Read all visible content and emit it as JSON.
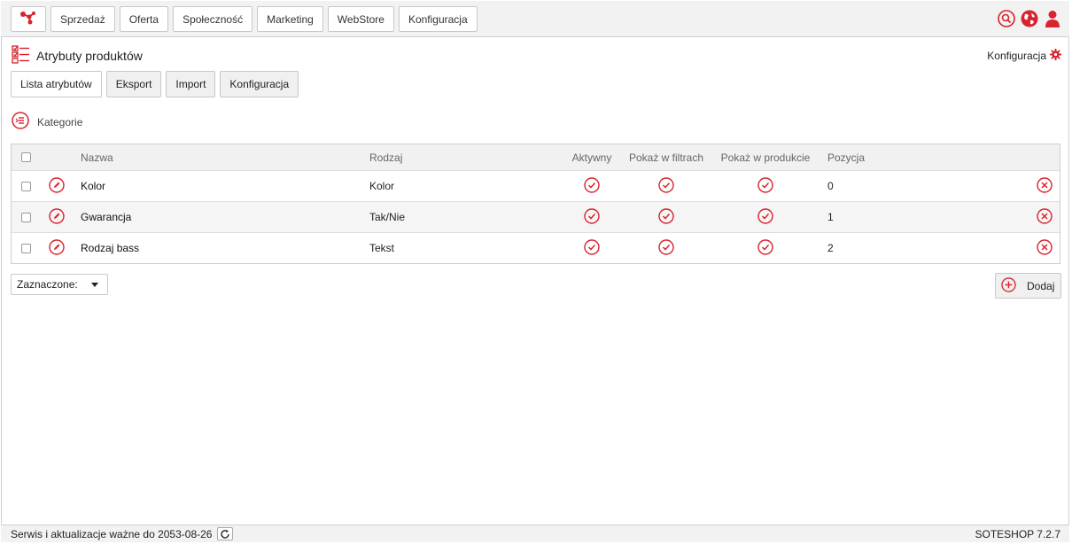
{
  "nav": [
    "Sprzedaż",
    "Oferta",
    "Społeczność",
    "Marketing",
    "WebStore",
    "Konfiguracja"
  ],
  "header": {
    "title": "Atrybuty produktów",
    "config_label": "Konfiguracja"
  },
  "tabs": [
    "Lista atrybutów",
    "Eksport",
    "Import",
    "Konfiguracja"
  ],
  "category_label": "Kategorie",
  "table": {
    "columns": [
      "Nazwa",
      "Rodzaj",
      "Aktywny",
      "Pokaż w filtrach",
      "Pokaż w produkcie",
      "Pozycja"
    ],
    "rows": [
      {
        "name": "Kolor",
        "type": "Kolor",
        "active": true,
        "filters": true,
        "product": true,
        "position": "0"
      },
      {
        "name": "Gwarancja",
        "type": "Tak/Nie",
        "active": true,
        "filters": true,
        "product": true,
        "position": "1"
      },
      {
        "name": "Rodzaj bass",
        "type": "Tekst",
        "active": true,
        "filters": true,
        "product": true,
        "position": "2"
      }
    ]
  },
  "bulk_select": {
    "value": "Zaznaczone:"
  },
  "add_button": "Dodaj",
  "footer": {
    "service_text": "Serwis i aktualizacje ważne do 2053-08-26",
    "version": "SOTESHOP 7.2.7"
  },
  "colors": {
    "accent": "#d9232d",
    "topbar": "#f2f2f2",
    "border": "#cfcfcf"
  },
  "icons": {
    "logo": "molecule-icon",
    "search": "search-icon",
    "globe": "globe-icon",
    "user": "user-icon",
    "title": "checklist-icon",
    "config": "gear-icon",
    "category": "category-list-icon",
    "edit": "pencil-icon",
    "check": "check-circle-icon",
    "delete": "close-circle-icon",
    "add": "plus-circle-icon",
    "refresh": "refresh-icon"
  }
}
